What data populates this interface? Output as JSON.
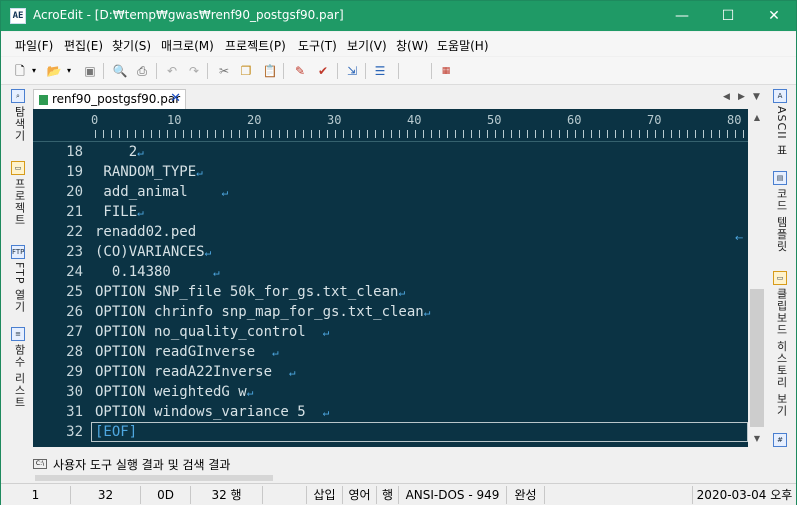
{
  "window": {
    "app_icon": "AE",
    "title": "AcroEdit - [D:₩temp₩gwas₩renf90_postgsf90.par]",
    "minimize": "—",
    "maximize": "☐",
    "close": "✕"
  },
  "menu": [
    "파일(F)",
    "편집(E)",
    "찾기(S)",
    "매크로(M)",
    "프로젝트(P)",
    "도구(T)",
    "보기(V)",
    "창(W)",
    "도움말(H)"
  ],
  "left_panel": [
    {
      "icon": "explorer-icon",
      "label": "탐색기"
    },
    {
      "icon": "project-icon",
      "label": "프로젝트"
    },
    {
      "icon": "ftp-icon",
      "glyph": "FTP",
      "label": "FTP 열기"
    },
    {
      "icon": "function-list-icon",
      "label": "함수 리스트"
    }
  ],
  "right_panel": [
    {
      "icon": "ascii-icon",
      "label": "ASCII 표"
    },
    {
      "icon": "code-template-icon",
      "label": "코드 템플릿"
    },
    {
      "icon": "clipboard-history-icon",
      "label": "클립보드 히스토리 보기"
    }
  ],
  "tab": {
    "label": "renf90_postgsf90.par",
    "close": "✕"
  },
  "ruler": [
    "0",
    "10",
    "20",
    "30",
    "40",
    "50",
    "60",
    "70",
    "80"
  ],
  "lines": [
    {
      "n": "18",
      "text": "    2",
      "cr": true
    },
    {
      "n": "19",
      "text": " RANDOM_TYPE",
      "cr": true
    },
    {
      "n": "20",
      "text": " add_animal    ",
      "cr": true
    },
    {
      "n": "21",
      "text": " FILE",
      "cr": true
    },
    {
      "n": "22",
      "text": "renadd02.ped",
      "cr": false
    },
    {
      "n": "23",
      "text": "(CO)VARIANCES",
      "cr": true
    },
    {
      "n": "24",
      "text": "  0.14380     ",
      "cr": true
    },
    {
      "n": "25",
      "text": "OPTION SNP_file 50k_for_gs.txt_clean",
      "cr": true
    },
    {
      "n": "26",
      "text": "OPTION chrinfo snp_map_for_gs.txt_clean",
      "cr": true
    },
    {
      "n": "27",
      "text": "OPTION no_quality_control  ",
      "cr": true
    },
    {
      "n": "28",
      "text": "OPTION readGInverse  ",
      "cr": true
    },
    {
      "n": "29",
      "text": "OPTION readA22Inverse  ",
      "cr": true
    },
    {
      "n": "30",
      "text": "OPTION weightedG w",
      "cr": true
    },
    {
      "n": "31",
      "text": "OPTION windows_variance 5  ",
      "cr": true
    },
    {
      "n": "32",
      "text": "[EOF]",
      "cr": false,
      "eof": true
    }
  ],
  "cr_glyph": "↵",
  "output_panel": {
    "label": "사용자 도구 실행 결과 및 검색 결과"
  },
  "status": {
    "line": "1",
    "column": "32",
    "char_hex": "0D",
    "line_count": "32 행",
    "insert_mode": "삽입",
    "input_lang": "영어",
    "row_label": "행",
    "encoding": "ANSI-DOS - 949",
    "state": "완성",
    "datetime": "2020-03-04 오후"
  }
}
